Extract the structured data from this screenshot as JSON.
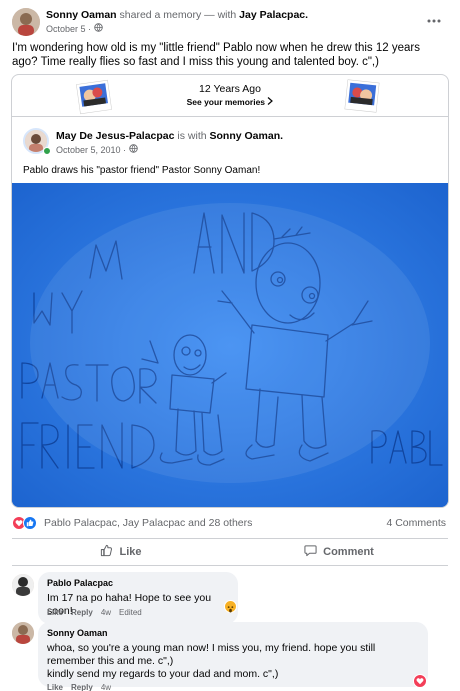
{
  "post": {
    "author": "Sonny Oaman",
    "action": "shared a memory — with",
    "tagged": "Jay Palacpac.",
    "date": "October 5 ·",
    "text": "I'm wondering how old is my \"little friend\" Pablo now when he drew this 12 years ago? Time really flies so fast and I miss this young and talented boy. c\",)"
  },
  "memory": {
    "title": "12 Years Ago",
    "link": "See your memories"
  },
  "shared": {
    "author": "May De Jesus-Palacpac",
    "with_text": "is with",
    "with_name": "Sonny Oaman.",
    "date": "October 5, 2010 ·",
    "caption": "Pablo draws his \"pastor friend\" Pastor Sonny Oaman!"
  },
  "drawing": {
    "words": [
      "AND",
      "MY",
      "PASTOR",
      "FRIEND",
      "PABLO"
    ]
  },
  "reactions": {
    "names": "Pablo Palacpac, Jay Palacpac and 28 others",
    "comments": "4 Comments"
  },
  "actions": {
    "like": "Like",
    "comment": "Comment"
  },
  "comments": [
    {
      "name": "Pablo Palacpac",
      "text": "Im 17 na po haha! Hope to see you soon!",
      "like": "Like",
      "reply": "Reply",
      "time": "4w",
      "edited": "Edited"
    },
    {
      "name": "Sonny Oaman",
      "text1": "whoa, so you're a young man now! I miss you, my friend. hope you still remember this and me. c\",)",
      "text2": "kindly send my regards to your dad and mom. c\",)",
      "like": "Like",
      "reply": "Reply",
      "time": "4w"
    }
  ],
  "colors": {
    "accent": "#1877f2",
    "photo_blue": "#2a79e4",
    "love": "#f33e58",
    "wow": "#f7b125"
  }
}
